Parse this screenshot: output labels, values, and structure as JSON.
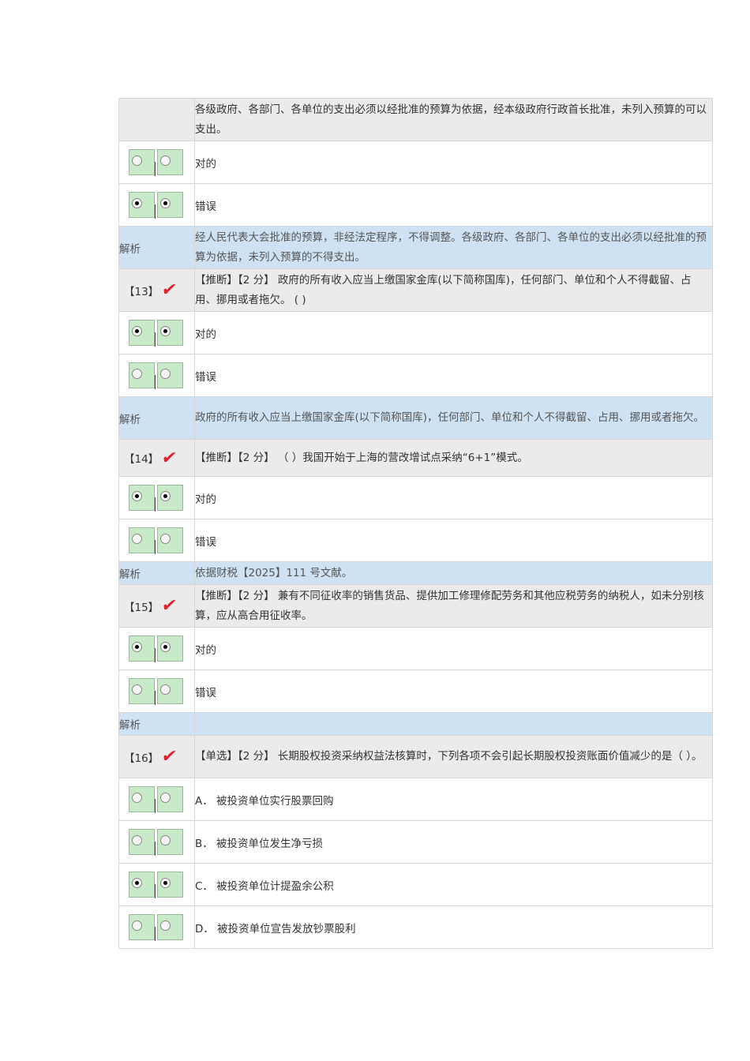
{
  "rows": [
    {
      "type": "stem",
      "num": "",
      "checked": false,
      "text": "各级政府、各部门、各单位的支出必须以经批准的预算为依据，经本级政府行政首长批准，未列入预算的可以支出。",
      "h": 54
    },
    {
      "type": "opt",
      "text": "对的",
      "selected": false,
      "h": 54
    },
    {
      "type": "opt",
      "text": "错误",
      "selected": true,
      "h": 54
    },
    {
      "type": "ana",
      "label": "解析",
      "text": "经人民代表大会批准的预算，非经法定程序，不得调整。各级政府、各部门、各单位的支出必须以经批准的预算为依据，未列入预算的不得支出。",
      "h": 54
    },
    {
      "type": "stem",
      "num": "【13】",
      "checked": true,
      "text": "【推断】【2 分】 政府的所有收入应当上缴国家金库(以下简称国库)，任何部门、单位和个人不得截留、占用、挪用或者拖欠。 ( )",
      "h": 54
    },
    {
      "type": "opt",
      "text": "对的",
      "selected": true,
      "h": 54
    },
    {
      "type": "opt",
      "text": "错误",
      "selected": false,
      "h": 54
    },
    {
      "type": "ana",
      "label": "解析",
      "text": "政府的所有收入应当上缴国家金库(以下简称国库)，任何部门、单位和个人不得截留、占用、挪用或者拖欠。",
      "h": 54
    },
    {
      "type": "stem",
      "num": "【14】",
      "checked": true,
      "text": "【推断】【2 分】 （  ）我国开始于上海的营改增试点采纳“6+1”模式。",
      "h": 47
    },
    {
      "type": "opt",
      "text": "对的",
      "selected": true,
      "h": 54
    },
    {
      "type": "opt",
      "text": "错误",
      "selected": false,
      "h": 54
    },
    {
      "type": "ana",
      "label": "解析",
      "text": "依据财税【2025】111 号文献。",
      "h": 29
    },
    {
      "type": "stem",
      "num": "【15】",
      "checked": true,
      "text": "【推断】【2 分】 兼有不同征收率的销售货品、提供加工修理修配劳务和其他应税劳务的纳税人，如未分别核算，应从高合用征收率。",
      "h": 54
    },
    {
      "type": "opt",
      "text": "对的",
      "selected": true,
      "h": 54
    },
    {
      "type": "opt",
      "text": "错误",
      "selected": false,
      "h": 54
    },
    {
      "type": "ana",
      "label": "解析",
      "text": "",
      "h": 29
    },
    {
      "type": "stem",
      "num": "【16】",
      "checked": true,
      "text": "【单选】【2 分】 长期股权投资采纳权益法核算时，下列各项不会引起长期股权投资账面价值减少的是（ ）。",
      "h": 54
    },
    {
      "type": "opt",
      "text": "A．  被投资单位实行股票回购",
      "selected": false,
      "h": 54
    },
    {
      "type": "opt",
      "text": "B．  被投资单位发生净亏损",
      "selected": false,
      "h": 54
    },
    {
      "type": "opt",
      "text": "C．  被投资单位计提盈余公积",
      "selected": true,
      "h": 54
    },
    {
      "type": "opt",
      "text": "D．  被投资单位宣告发放钞票股利",
      "selected": false,
      "h": 54
    }
  ]
}
